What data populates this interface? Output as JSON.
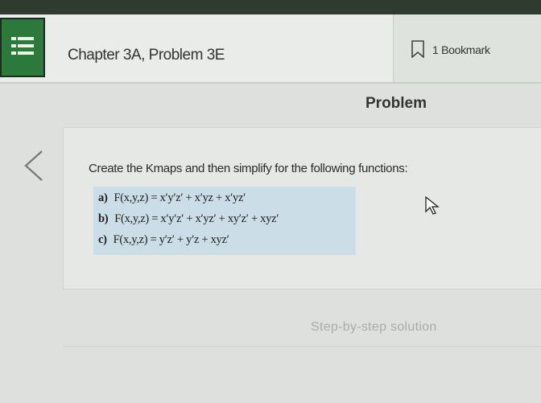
{
  "header": {
    "chapter_title": "Chapter 3A, Problem 3E",
    "bookmark_label": "1 Bookmark"
  },
  "main": {
    "heading": "Problem",
    "prompt": "Create the Kmaps and then simplify for the following functions:",
    "equations": [
      {
        "label": "a)",
        "text": "F(x,y,z) = x′y′z′ + x′yz + x′yz′"
      },
      {
        "label": "b)",
        "text": "F(x,y,z) = x′y′z′ + x′yz′ + xy′z′ + xyz′"
      },
      {
        "label": "c)",
        "text": "F(x,y,z) = y′z′ + y′z + xyz′"
      }
    ],
    "step_label": "Step-by-step solution"
  },
  "colors": {
    "menu_bg": "#2b7a3b",
    "equation_highlight": "#cbdde6"
  },
  "icons": [
    "menu-icon",
    "bookmark-icon",
    "chevron-left-icon",
    "cursor-icon"
  ]
}
